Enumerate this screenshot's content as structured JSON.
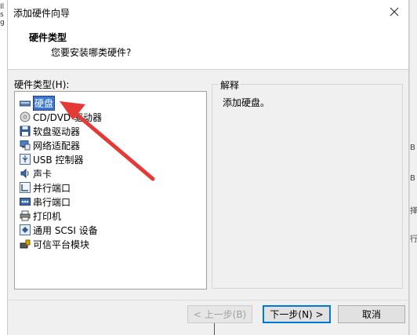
{
  "background": {
    "left_fragments": [
      "Il",
      "s",
      "g"
    ],
    "right_fragments": [
      "B",
      "B",
      "择",
      "行"
    ]
  },
  "window": {
    "title": "添加硬件向导"
  },
  "header": {
    "title": "硬件类型",
    "subtitle": "您要安装哪类硬件?"
  },
  "hardware_list": {
    "label": "硬件类型(H):",
    "items": [
      {
        "label": "硬盘",
        "icon": "hard-disk-icon",
        "selected": true
      },
      {
        "label": "CD/DVD 驱动器",
        "icon": "cd-dvd-icon"
      },
      {
        "label": "软盘驱动器",
        "icon": "floppy-icon"
      },
      {
        "label": "网络适配器",
        "icon": "network-adapter-icon"
      },
      {
        "label": "USB 控制器",
        "icon": "usb-icon"
      },
      {
        "label": "声卡",
        "icon": "sound-card-icon"
      },
      {
        "label": "并行端口",
        "icon": "parallel-port-icon"
      },
      {
        "label": "串行端口",
        "icon": "serial-port-icon"
      },
      {
        "label": "打印机",
        "icon": "printer-icon"
      },
      {
        "label": "通用 SCSI 设备",
        "icon": "scsi-icon"
      },
      {
        "label": "可信平台模块",
        "icon": "tpm-icon"
      }
    ]
  },
  "explanation": {
    "label": "解释",
    "text": "添加硬盘。"
  },
  "buttons": {
    "prev": "< 上一步(B)",
    "next": "下一步(N) >",
    "cancel": "取消"
  },
  "annotation": {
    "arrow_color": "#e53935"
  },
  "colors": {
    "selection": "#3a78d6",
    "focus_border": "#0078d7"
  }
}
